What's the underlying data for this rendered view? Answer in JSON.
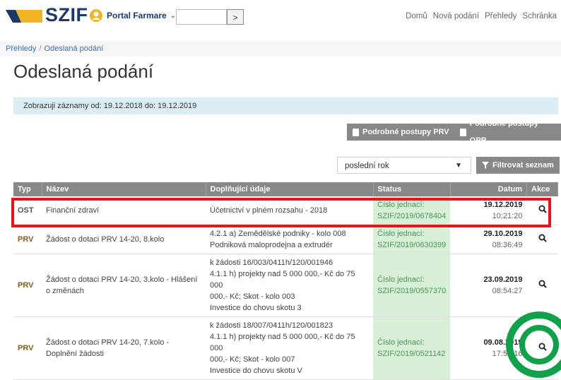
{
  "header": {
    "logo": "SZIF",
    "portal_label": "Portal Farmare",
    "search_value": "",
    "nav": [
      "Domů",
      "Nová podání",
      "Přehledy",
      "Schránka"
    ]
  },
  "breadcrumb": {
    "parent": "Přehledy",
    "current": "Odeslaná podání"
  },
  "page_title": "Odeslaná podání",
  "info_text": "Zobrazuji záznamy od: 19.12.2018 do: 19.12.2019",
  "buttons": {
    "prv": "Podrobné postupy PRV",
    "opr": "Podrobné postupy OPR",
    "filter": "Filtrovat seznam"
  },
  "filter_select": {
    "value": "poslední rok"
  },
  "table": {
    "headers": [
      "Typ",
      "Název",
      "Doplňující údaje",
      "Status",
      "Datum",
      "Akce"
    ],
    "rows": [
      {
        "typ": "OST",
        "nazev": "Finanční zdraví",
        "udaje": [
          "Účetnictví v plném rozsahu - 2018"
        ],
        "status": [
          "Číslo jednací:",
          "SZIF/2019/0678404"
        ],
        "date": "19.12.2019",
        "time": "10:21:20"
      },
      {
        "typ": "PRV",
        "nazev": "Žádost o dotaci PRV 14-20, 8.kolo",
        "udaje": [
          "4.2.1 a) Zemědělské podniky - kolo 008",
          "Podniková maloprodejna a extrudér"
        ],
        "status": [
          "Číslo jednací:",
          "SZIF/2019/0630399"
        ],
        "date": "29.10.2019",
        "time": "08:36:49"
      },
      {
        "typ": "PRV",
        "nazev": "Žádost o dotaci PRV 14-20, 3.kolo - Hlášení o změnách",
        "udaje": [
          "k žádosti 16/003/0411h/120/001946",
          "4.1.1 h) projekty nad 5 000 000,- Kč do 75 000",
          "000,- Kč; Skot - kolo 003",
          "Investice do chovu skotu 3"
        ],
        "status": [
          "Číslo jednací:",
          "SZIF/2019/0557370"
        ],
        "date": "23.09.2019",
        "time": "08:54:27"
      },
      {
        "typ": "PRV",
        "nazev": "Žádost o dotaci PRV 14-20, 7.kolo - Doplnění žádosti",
        "udaje": [
          "k žádosti 18/007/0411h/120/001823",
          "4.1.1 h) projekty nad 5 000 000,- Kč do 75 000",
          "000,- Kč; Skot - kolo 007",
          "Investice do chovu skotu V"
        ],
        "status": [
          "Číslo jednací:",
          "SZIF/2019/0521142"
        ],
        "date": "09.08.2019",
        "time": "17:51:16"
      }
    ]
  },
  "colors": {
    "highlight_red": "#e8141d",
    "highlight_green": "#12a14b",
    "status_bg": "#d6efd6",
    "header_gray": "#888888"
  }
}
